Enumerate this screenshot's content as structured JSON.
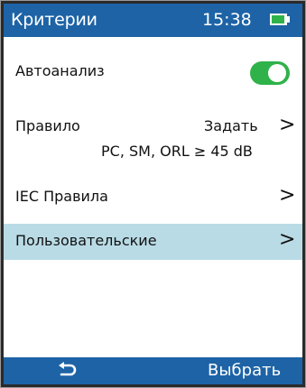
{
  "header": {
    "title": "Критерии",
    "time": "15:38",
    "battery_icon": "battery-icon"
  },
  "rows": {
    "auto_analysis": {
      "label": "Автоанализ",
      "toggle_on": true
    },
    "rule": {
      "label": "Правило",
      "action": "Задать",
      "chevron": ">",
      "detail": "PC, SM, ORL ≥ 45 dB"
    },
    "iec": {
      "label": "IEC Правила",
      "chevron": ">"
    },
    "custom": {
      "label": "Пользовательские",
      "chevron": ">"
    }
  },
  "footer": {
    "back_icon": "back-arrow-icon",
    "select_label": "Выбрать"
  },
  "colors": {
    "header": "#1d63a6",
    "accent_green": "#2fb24a",
    "highlight": "#b9dbe6"
  }
}
